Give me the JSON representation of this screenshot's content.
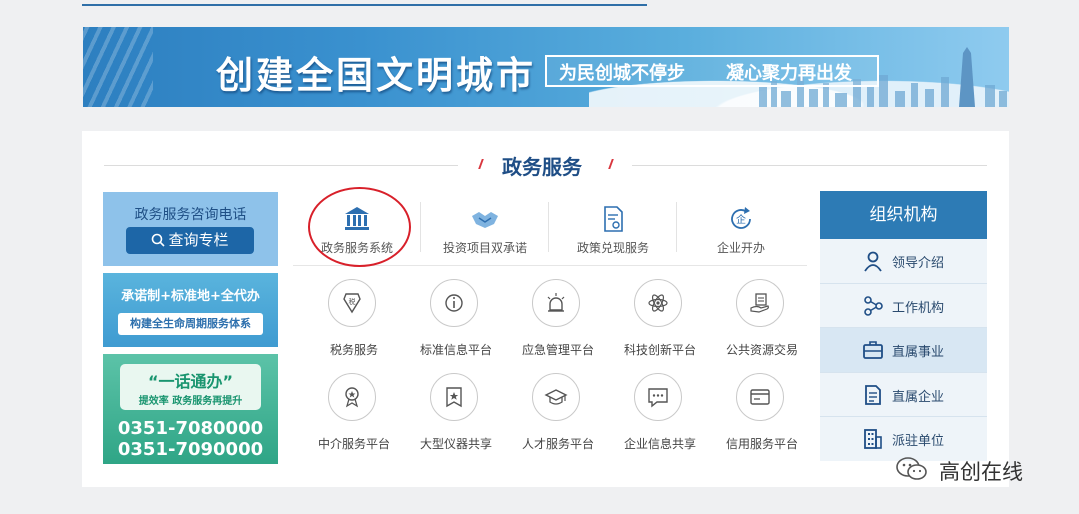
{
  "banner": {
    "title": "创建全国文明城市",
    "slogan1": "为民创城不停步",
    "slogan2": "凝心聚力再出发"
  },
  "section": {
    "title": "政务服务"
  },
  "left_cards": {
    "consult": {
      "title": "政务服务咨询电话",
      "button": "查询专栏"
    },
    "system": {
      "line1": "承诺制+标准地+全代办",
      "line2": "构建全生命周期服务体系"
    },
    "hotline": {
      "title": "“一话通办”",
      "subtitle": "提效率 政务服务再提升",
      "phone1": "0351-7080000",
      "phone2": "0351-7090000"
    }
  },
  "tabs": [
    {
      "label": "政务服务系统",
      "icon": "government-building-icon"
    },
    {
      "label": "投资项目双承诺",
      "icon": "handshake-icon"
    },
    {
      "label": "政策兑现服务",
      "icon": "policy-document-icon"
    },
    {
      "label": "企业开办",
      "icon": "enterprise-refresh-icon"
    }
  ],
  "grid": [
    {
      "label": "税务服务",
      "icon": "tax-icon"
    },
    {
      "label": "标准信息平台",
      "icon": "standard-info-icon"
    },
    {
      "label": "应急管理平台",
      "icon": "emergency-alarm-icon"
    },
    {
      "label": "科技创新平台",
      "icon": "atom-icon"
    },
    {
      "label": "公共资源交易",
      "icon": "hand-document-icon"
    },
    {
      "label": "中介服务平台",
      "icon": "award-medal-icon"
    },
    {
      "label": "大型仪器共享",
      "icon": "bookmark-star-icon"
    },
    {
      "label": "人才服务平台",
      "icon": "graduation-cap-icon"
    },
    {
      "label": "企业信息共享",
      "icon": "chat-bubble-icon"
    },
    {
      "label": "信用服务平台",
      "icon": "credit-card-icon"
    }
  ],
  "org": {
    "title": "组织机构",
    "items": [
      {
        "label": "领导介绍",
        "icon": "person-icon"
      },
      {
        "label": "工作机构",
        "icon": "network-nodes-icon"
      },
      {
        "label": "直属事业",
        "icon": "briefcase-icon"
      },
      {
        "label": "直属企业",
        "icon": "building-document-icon"
      },
      {
        "label": "派驻单位",
        "icon": "office-building-icon"
      }
    ]
  },
  "watermark": {
    "text": "高创在线",
    "icon": "wechat-icon"
  },
  "colors": {
    "brand_blue": "#1f4e86",
    "accent_red": "#d8202a",
    "org_header": "#2d7bb5"
  }
}
